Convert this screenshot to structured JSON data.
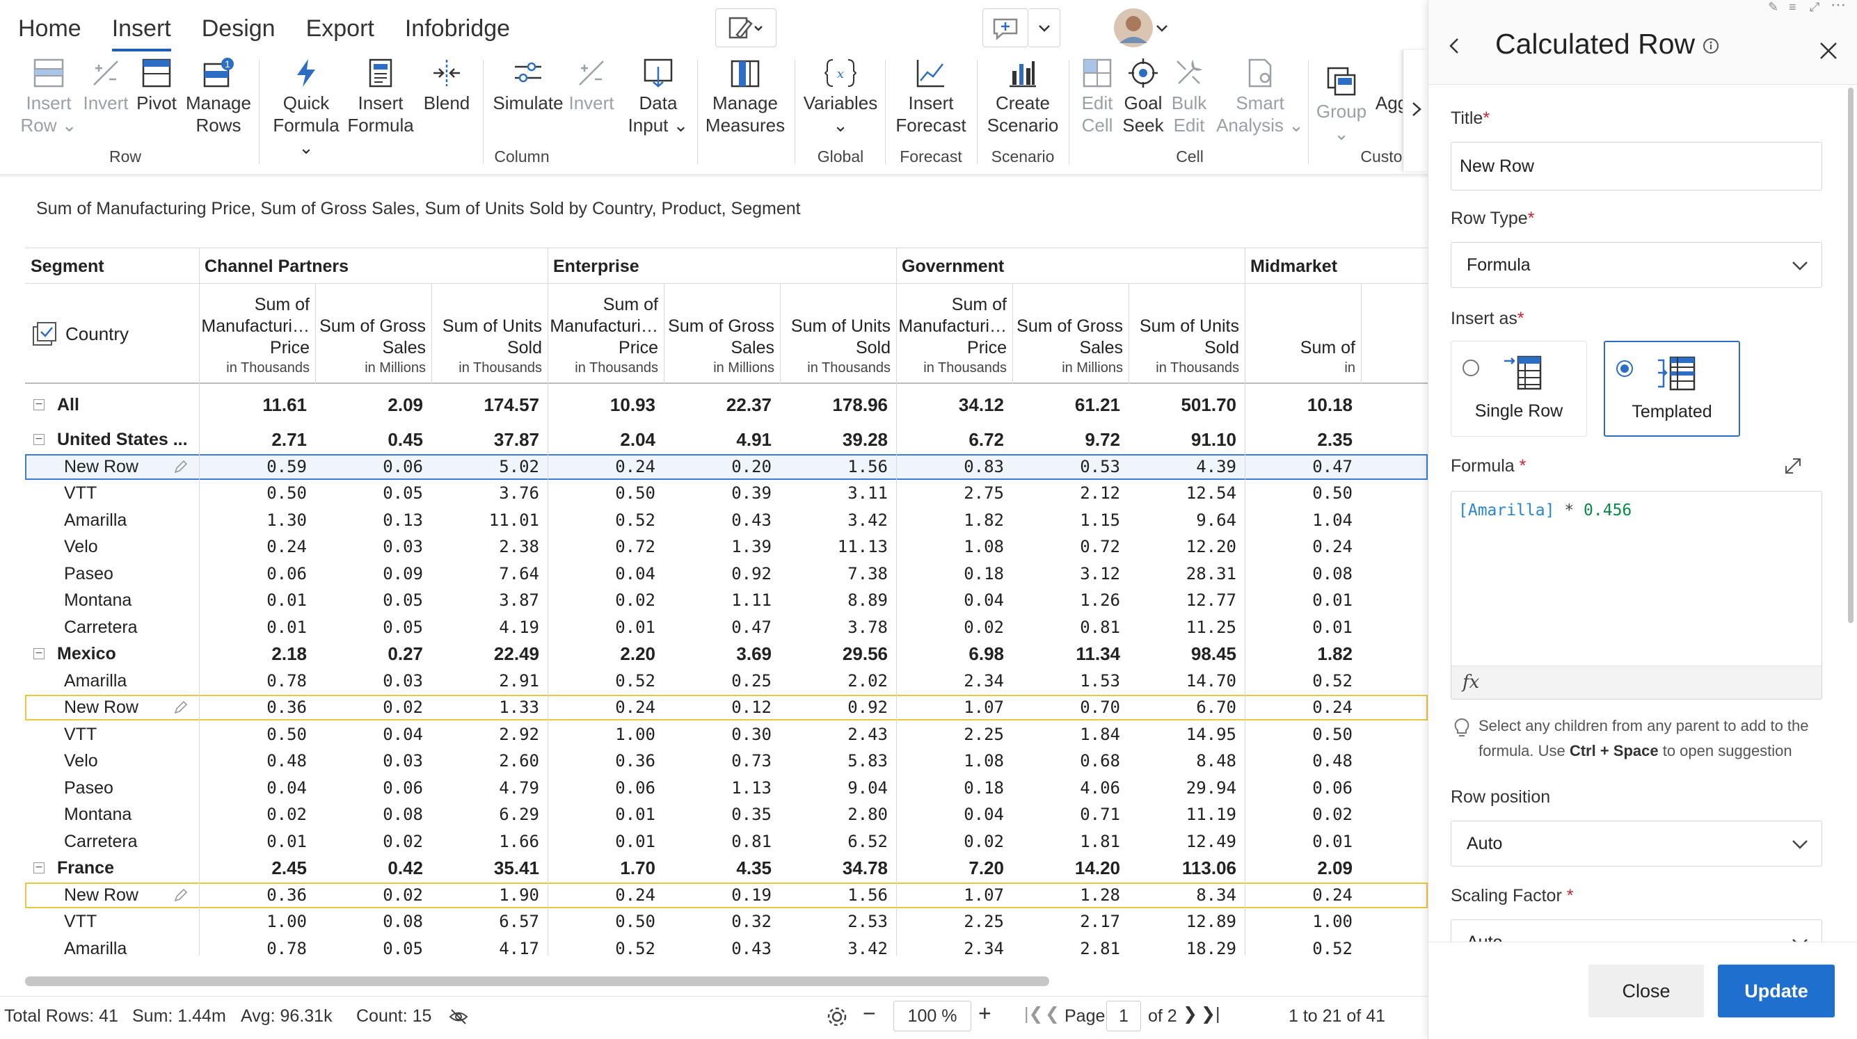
{
  "menu": {
    "tabs": [
      "Home",
      "Insert",
      "Design",
      "Export",
      "Infobridge"
    ],
    "active_tab": "Insert"
  },
  "ribbon": {
    "insert_row": [
      "Insert",
      "Row"
    ],
    "invert_row": "Invert",
    "pivot": "Pivot",
    "manage_rows": [
      "Manage",
      "Rows"
    ],
    "manage_rows_badge": "1",
    "quick_formula": [
      "Quick",
      "Formula"
    ],
    "insert_formula": [
      "Insert",
      "Formula"
    ],
    "blend": "Blend",
    "simulate": "Simulate",
    "invert_col": "Invert",
    "data_input": [
      "Data",
      "Input"
    ],
    "manage_measures": [
      "Manage",
      "Measures"
    ],
    "variables": "Variables",
    "insert_forecast": [
      "Insert",
      "Forecast"
    ],
    "create_scenario": [
      "Create",
      "Scenario"
    ],
    "edit_cell": [
      "Edit",
      "Cell"
    ],
    "goal_seek": [
      "Goal",
      "Seek"
    ],
    "bulk_edit": [
      "Bulk",
      "Edit"
    ],
    "smart_analysis": [
      "Smart",
      "Analysis"
    ],
    "group": "Group",
    "agg": "Agg",
    "groups": {
      "row": "Row",
      "column": "Column",
      "global": "Global",
      "forecast": "Forecast",
      "scenario": "Scenario",
      "cell": "Cell",
      "custom": "Custom"
    }
  },
  "subtitle": "Sum of Manufacturing Price, Sum of Gross Sales, Sum of Units Sold by Country, Product, Segment",
  "grid": {
    "segment_header": "Segment",
    "country_header": "Country",
    "segments": [
      "Channel Partners",
      "Enterprise",
      "Government",
      "Midmarket"
    ],
    "measures": [
      {
        "name": [
          "Sum of",
          "Manufacturi…",
          "Price"
        ],
        "unit": "in Thousands"
      },
      {
        "name": [
          "Sum of Gross",
          "Sales"
        ],
        "unit": "in Millions"
      },
      {
        "name": [
          "Sum of Units",
          "Sold"
        ],
        "unit": "in Thousands"
      }
    ],
    "truncated_measure": "Sum of",
    "truncated_unit": "in",
    "rows": [
      {
        "label": "All",
        "type": "grp",
        "toggle": "−",
        "values": [
          "11.61",
          "2.09",
          "174.57",
          "10.93",
          "22.37",
          "178.96",
          "34.12",
          "61.21",
          "501.70",
          "10.18"
        ]
      },
      {
        "label": "United States ...",
        "type": "grp",
        "toggle": "−",
        "values": [
          "2.71",
          "0.45",
          "37.87",
          "2.04",
          "4.91",
          "39.28",
          "6.72",
          "9.72",
          "91.10",
          "2.35"
        ]
      },
      {
        "label": "New Row",
        "type": "sel",
        "values": [
          "0.59",
          "0.06",
          "5.02",
          "0.24",
          "0.20",
          "1.56",
          "0.83",
          "0.53",
          "4.39",
          "0.47"
        ]
      },
      {
        "label": "VTT",
        "type": "item",
        "values": [
          "0.50",
          "0.05",
          "3.76",
          "0.50",
          "0.39",
          "3.11",
          "2.75",
          "2.12",
          "12.54",
          "0.50"
        ]
      },
      {
        "label": "Amarilla",
        "type": "item",
        "values": [
          "1.30",
          "0.13",
          "11.01",
          "0.52",
          "0.43",
          "3.42",
          "1.82",
          "1.15",
          "9.64",
          "1.04"
        ]
      },
      {
        "label": "Velo",
        "type": "item",
        "values": [
          "0.24",
          "0.03",
          "2.38",
          "0.72",
          "1.39",
          "11.13",
          "1.08",
          "0.72",
          "12.20",
          "0.24"
        ]
      },
      {
        "label": "Paseo",
        "type": "item",
        "values": [
          "0.06",
          "0.09",
          "7.64",
          "0.04",
          "0.92",
          "7.38",
          "0.18",
          "3.12",
          "28.31",
          "0.08"
        ]
      },
      {
        "label": "Montana",
        "type": "item",
        "values": [
          "0.01",
          "0.05",
          "3.87",
          "0.02",
          "1.11",
          "8.89",
          "0.04",
          "1.26",
          "12.77",
          "0.01"
        ]
      },
      {
        "label": "Carretera",
        "type": "item",
        "values": [
          "0.01",
          "0.05",
          "4.19",
          "0.01",
          "0.47",
          "3.78",
          "0.02",
          "0.81",
          "11.25",
          "0.01"
        ]
      },
      {
        "label": "Mexico",
        "type": "grp",
        "toggle": "−",
        "values": [
          "2.18",
          "0.27",
          "22.49",
          "2.20",
          "3.69",
          "29.56",
          "6.98",
          "11.34",
          "98.45",
          "1.82"
        ]
      },
      {
        "label": "Amarilla",
        "type": "item",
        "values": [
          "0.78",
          "0.03",
          "2.91",
          "0.52",
          "0.25",
          "2.02",
          "2.34",
          "1.53",
          "14.70",
          "0.52"
        ]
      },
      {
        "label": "New Row",
        "type": "hi",
        "values": [
          "0.36",
          "0.02",
          "1.33",
          "0.24",
          "0.12",
          "0.92",
          "1.07",
          "0.70",
          "6.70",
          "0.24"
        ]
      },
      {
        "label": "VTT",
        "type": "item",
        "values": [
          "0.50",
          "0.04",
          "2.92",
          "1.00",
          "0.30",
          "2.43",
          "2.25",
          "1.84",
          "14.95",
          "0.50"
        ]
      },
      {
        "label": "Velo",
        "type": "item",
        "values": [
          "0.48",
          "0.03",
          "2.60",
          "0.36",
          "0.73",
          "5.83",
          "1.08",
          "0.68",
          "8.48",
          "0.48"
        ]
      },
      {
        "label": "Paseo",
        "type": "item",
        "values": [
          "0.04",
          "0.06",
          "4.79",
          "0.06",
          "1.13",
          "9.04",
          "0.18",
          "4.06",
          "29.94",
          "0.06"
        ]
      },
      {
        "label": "Montana",
        "type": "item",
        "values": [
          "0.02",
          "0.08",
          "6.29",
          "0.01",
          "0.35",
          "2.80",
          "0.04",
          "0.71",
          "11.19",
          "0.02"
        ]
      },
      {
        "label": "Carretera",
        "type": "item",
        "values": [
          "0.01",
          "0.02",
          "1.66",
          "0.01",
          "0.81",
          "6.52",
          "0.02",
          "1.81",
          "12.49",
          "0.01"
        ]
      },
      {
        "label": "France",
        "type": "grp",
        "toggle": "−",
        "values": [
          "2.45",
          "0.42",
          "35.41",
          "1.70",
          "4.35",
          "34.78",
          "7.20",
          "14.20",
          "113.06",
          "2.09"
        ]
      },
      {
        "label": "New Row",
        "type": "hi",
        "values": [
          "0.36",
          "0.02",
          "1.90",
          "0.24",
          "0.19",
          "1.56",
          "1.07",
          "1.28",
          "8.34",
          "0.24"
        ]
      },
      {
        "label": "VTT",
        "type": "item",
        "values": [
          "1.00",
          "0.08",
          "6.57",
          "0.50",
          "0.32",
          "2.53",
          "2.25",
          "2.17",
          "12.89",
          "1.00"
        ]
      },
      {
        "label": "Amarilla",
        "type": "item",
        "values": [
          "0.78",
          "0.05",
          "4.17",
          "0.52",
          "0.43",
          "3.42",
          "2.34",
          "2.81",
          "18.29",
          "0.52"
        ]
      }
    ]
  },
  "status": {
    "total_rows": "Total Rows: 41",
    "sum": "Sum: 1.44m",
    "avg": "Avg: 96.31k",
    "count": "Count: 15",
    "zoom": "100 %",
    "page_label": "Page",
    "page_value": "1",
    "page_of": "of 2",
    "range": "1 to 21 of 41"
  },
  "panel": {
    "title": "Calculated Row",
    "title_label": "Title",
    "title_value": "New Row",
    "row_type_label": "Row Type",
    "row_type_value": "Formula",
    "insert_as_label": "Insert as",
    "insert_options": [
      "Single Row",
      "Templated"
    ],
    "insert_selected": "Templated",
    "formula_label": "Formula",
    "formula_ref": "[Amarilla]",
    "formula_op": " * ",
    "formula_num": "0.456",
    "fx": "fx",
    "hint_pre": "Select any children from any parent to add to the formula. Use ",
    "hint_key": "Ctrl + Space",
    "hint_post": " to open suggestion",
    "row_position_label": "Row position",
    "row_position_value": "Auto",
    "scaling_label": "Scaling Factor",
    "scaling_value": "Auto",
    "close_label": "Close",
    "update_label": "Update"
  },
  "colors": {
    "accent": "#1f6fcf",
    "selected_row_border": "#3f7bd6",
    "new_row_border": "#e7c843",
    "formula_ref": "#2a86d1",
    "formula_number": "#0a8a4a"
  }
}
